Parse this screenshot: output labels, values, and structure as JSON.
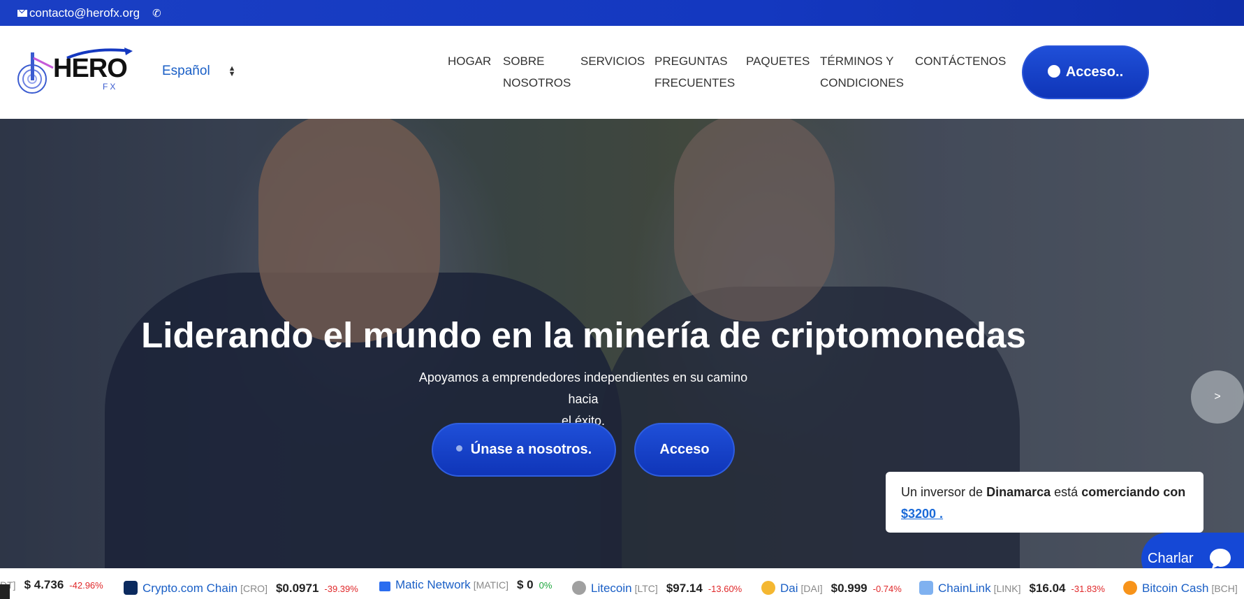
{
  "topbar": {
    "email": "contacto@herofx.org"
  },
  "header": {
    "logo_main": "HERO",
    "logo_sub": "FX",
    "language": "Español",
    "nav": [
      {
        "line1": "HOGAR",
        "line2": ""
      },
      {
        "line1": "SOBRE",
        "line2": "NOSOTROS"
      },
      {
        "line1": "SERVICIOS",
        "line2": ""
      },
      {
        "line1": "PREGUNTAS",
        "line2": "FRECUENTES"
      },
      {
        "line1": "PAQUETES",
        "line2": ""
      },
      {
        "line1": "TÉRMINOS Y",
        "line2": "CONDICIONES"
      },
      {
        "line1": "CONTÁCTENOS",
        "line2": ""
      }
    ],
    "login_label": "Acceso.."
  },
  "hero": {
    "title": "Liderando el mundo en la minería de criptomonedas",
    "subtitle_line1": "Apoyamos a emprendedores independientes en su camino hacia",
    "subtitle_line2": "el éxito.",
    "join_label": "Únase a nosotros.",
    "access_label": "Acceso",
    "next_label": ">"
  },
  "notice": {
    "prefix": "Un inversor de",
    "country": "Dinamarca",
    "middle": "está",
    "action": "comerciando con",
    "amount": "$3200 ."
  },
  "chat": {
    "label": "Charlar"
  },
  "ticker": [
    {
      "name": "",
      "symbol": "DT]",
      "price": "$ 4.736",
      "change": "-42.96%",
      "trend": "neg",
      "color": ""
    },
    {
      "name": "Crypto.com Chain",
      "symbol": "[CRO]",
      "price": "$0.0971",
      "change": "-39.39%",
      "trend": "neg",
      "color": "#0b2a5e"
    },
    {
      "name": "Matic Network",
      "symbol": "[MATIC]",
      "price": "$ 0",
      "change": "0%",
      "trend": "pos",
      "color": "#2b6def"
    },
    {
      "name": "Litecoin",
      "symbol": "[LTC]",
      "price": "$97.14",
      "change": "-13.60%",
      "trend": "neg",
      "color": "#a0a0a0"
    },
    {
      "name": "Dai",
      "symbol": "[DAI]",
      "price": "$0.999",
      "change": "-0.74%",
      "trend": "neg",
      "color": "#f4b731"
    },
    {
      "name": "ChainLink",
      "symbol": "[LINK]",
      "price": "$16.04",
      "change": "-31.83%",
      "trend": "neg",
      "color": "#7fb1f0"
    },
    {
      "name": "Bitcoin Cash",
      "symbol": "[BCH]",
      "price": "",
      "change": "",
      "trend": "neg",
      "color": "#f7931a"
    }
  ],
  "colors": {
    "brand_blue": "#1438c0",
    "link_blue": "#1a5fc6",
    "negative": "#e0282a",
    "positive": "#1aa53a"
  }
}
